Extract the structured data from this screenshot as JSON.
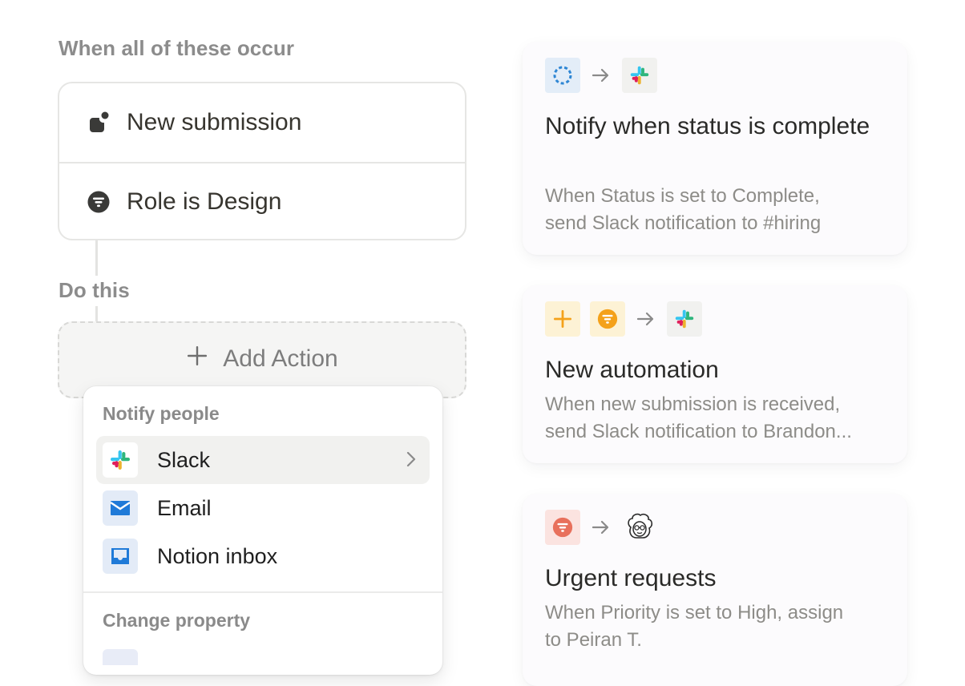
{
  "left": {
    "when_label": "When all of these occur",
    "triggers": [
      {
        "label": "New submission",
        "icon": "new-submission-icon"
      },
      {
        "label": "Role is Design",
        "icon": "filter-icon"
      }
    ],
    "do_label": "Do this",
    "add_action": {
      "label": "Add Action",
      "icon": "plus-icon"
    },
    "menu": {
      "sections": [
        {
          "heading": "Notify people",
          "items": [
            {
              "label": "Slack",
              "icon": "slack-icon",
              "selected": true,
              "has_submenu": true
            },
            {
              "label": "Email",
              "icon": "mail-icon"
            },
            {
              "label": "Notion inbox",
              "icon": "inbox-icon"
            }
          ]
        },
        {
          "heading": "Change property",
          "items": []
        }
      ]
    }
  },
  "cards": [
    {
      "trigger_icon": "status-circle-icon",
      "action_icon": "slack-icon",
      "title": "Notify when status is complete",
      "description_lines": [
        "When Status is set to Complete,",
        "send Slack notification to #hiring"
      ]
    },
    {
      "trigger_icons": [
        "plus-icon",
        "filter-icon"
      ],
      "action_icon": "slack-icon",
      "title": "New automation",
      "description_lines": [
        "When new submission is received,",
        "send Slack notification to Brandon..."
      ]
    },
    {
      "trigger_icon": "filter-icon",
      "action_icon": "avatar-icon",
      "title": "Urgent requests",
      "description_lines": [
        "When Priority is set to High, assign",
        "to Peiran T."
      ]
    }
  ],
  "colors": {
    "section_label": "#8c8c8c",
    "border": "#e6e6e4",
    "slack_chip_bg": "#f1f1ef",
    "status_chip_bg": "#e3edf8",
    "status_blue": "#2e86d4",
    "yellow_chip_bg": "#fdf2d5",
    "yellow": "#f4a11a",
    "red_chip_bg": "#fbe3e0",
    "red": "#e8705c",
    "email_chip_bg": "#e3ebf7",
    "email_blue": "#1f7ad8"
  }
}
